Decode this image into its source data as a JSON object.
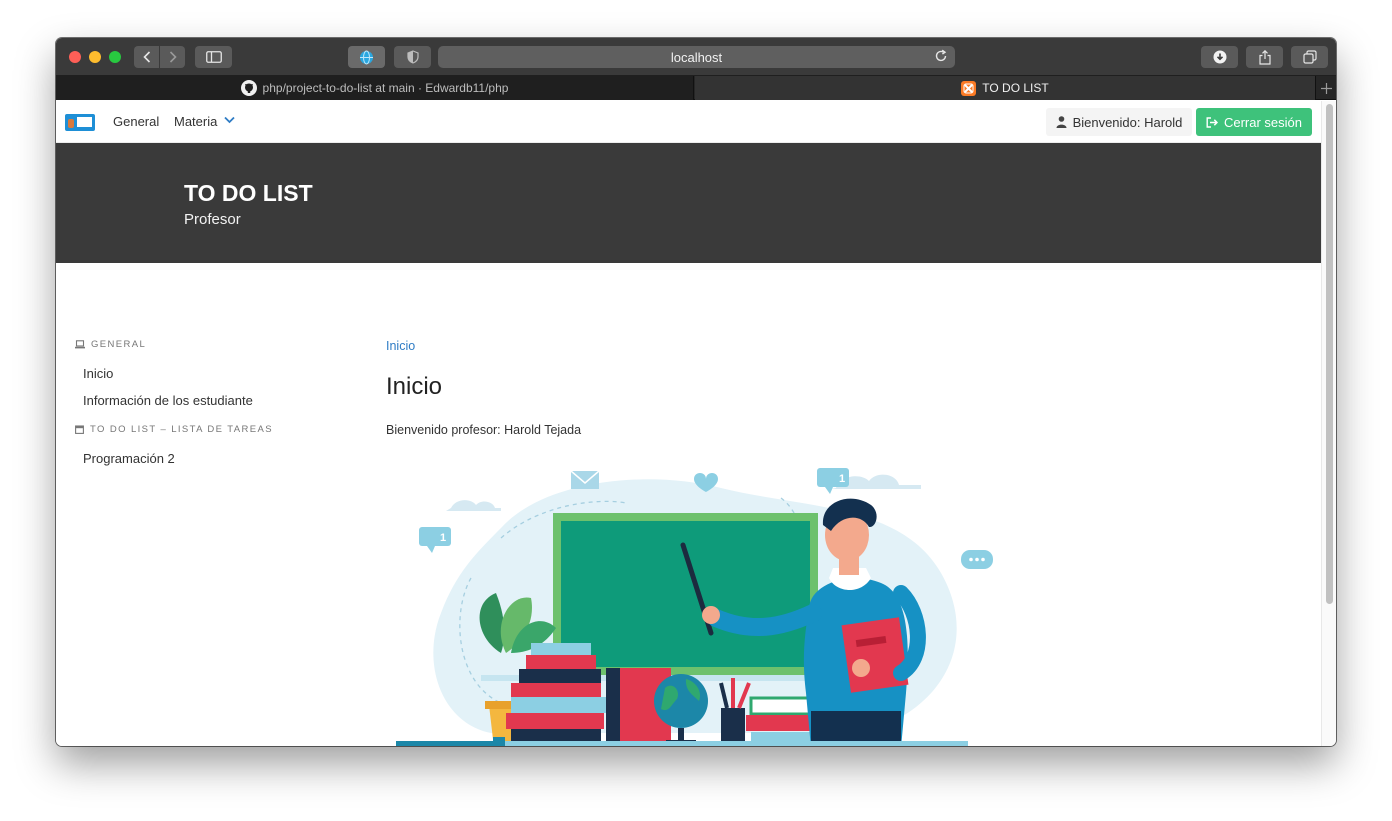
{
  "browser": {
    "url": "localhost",
    "tabs": [
      {
        "label": "php/project-to-do-list at main · Edwardb11/php",
        "active": false
      },
      {
        "label": "TO DO LIST",
        "active": true
      }
    ]
  },
  "navbar": {
    "links": [
      "General",
      "Materia"
    ],
    "welcome": "Bienvenido: Harold",
    "logout": "Cerrar sesión"
  },
  "hero": {
    "title": "TO DO LIST",
    "subtitle": "Profesor"
  },
  "sidebar": {
    "sections": [
      {
        "heading": "GENERAL",
        "items": [
          "Inicio",
          "Información de los estudiante"
        ]
      },
      {
        "heading": "TO DO LIST – LISTA DE TAREAS",
        "items": [
          "Programación 2"
        ]
      }
    ]
  },
  "main": {
    "breadcrumb": "Inicio",
    "title": "Inicio",
    "text": "Bienvenido profesor: Harold Tejada",
    "illustration_badges": [
      "1",
      "1"
    ]
  },
  "colors": {
    "accent_green": "#3ec27b",
    "link_blue": "#2e7cc5",
    "hero_bg": "#3a3a3a",
    "chalkboard": "#0e9b7a"
  }
}
